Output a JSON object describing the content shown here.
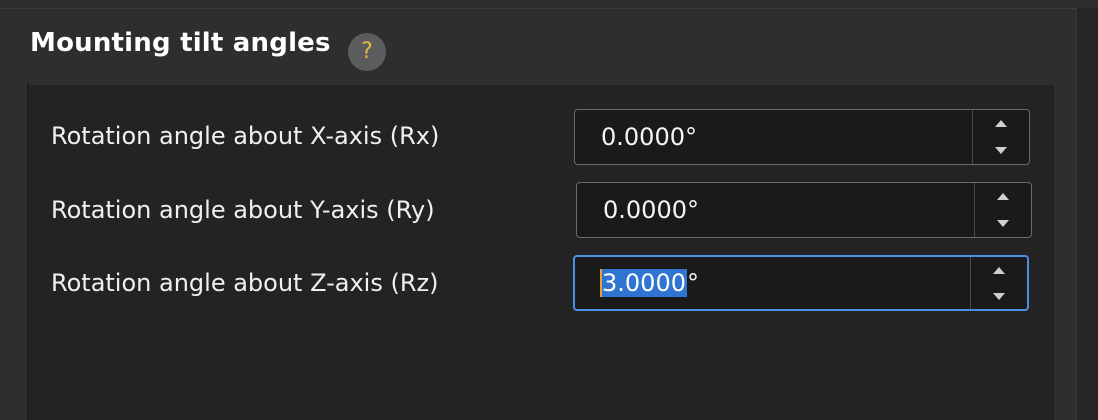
{
  "section": {
    "title": "Mounting tilt angles",
    "help_icon_glyph": "?"
  },
  "rows": [
    {
      "label": "Rotation angle about X-axis (Rx)",
      "value": "0.0000°",
      "focused": false
    },
    {
      "label": "Rotation angle about Y-axis (Ry)",
      "value": "0.0000°",
      "focused": false
    },
    {
      "label": "Rotation angle about Z-axis (Rz)",
      "value_selected": "3.0000",
      "value_suffix": "°",
      "focused": true
    }
  ],
  "colors": {
    "accent": "#4a90e2",
    "selection": "#2f74d0",
    "help_glyph": "#e2b84a"
  }
}
